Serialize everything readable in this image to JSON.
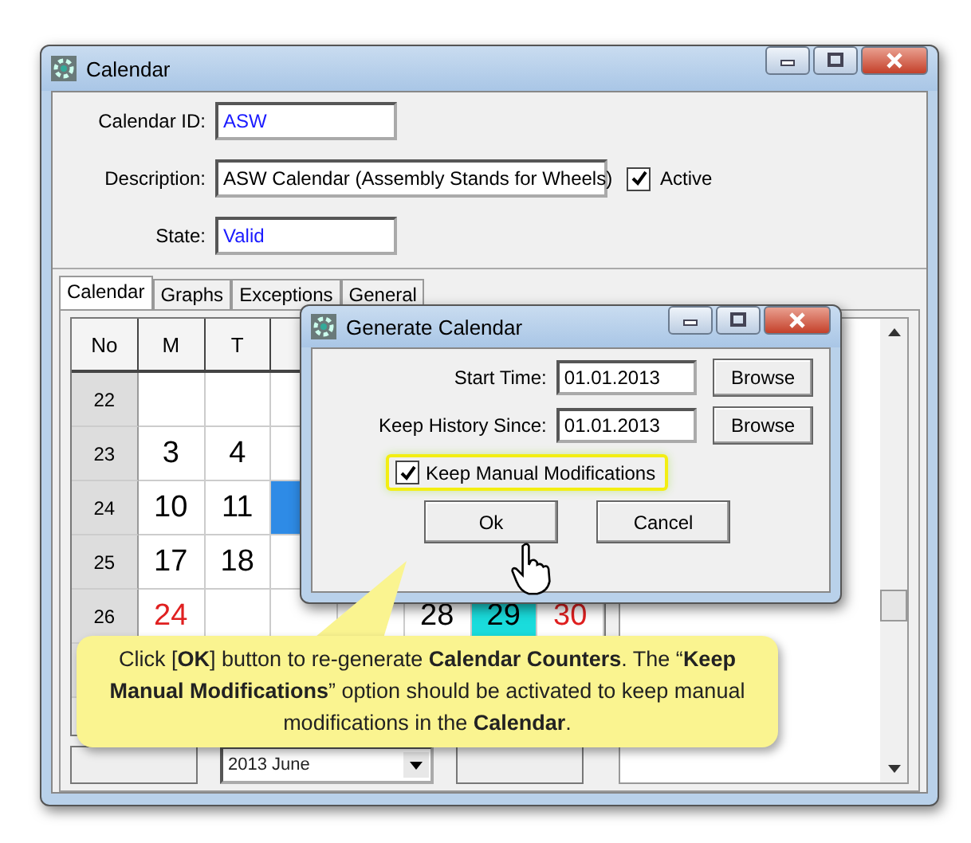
{
  "window": {
    "title": "Calendar"
  },
  "fields": [
    {
      "label": "Calendar ID:",
      "value": "ASW",
      "kind": "short"
    },
    {
      "label": "Description:",
      "value": "ASW Calendar (Assembly Stands for Wheels)",
      "kind": "long"
    },
    {
      "label": "State:",
      "value": "Valid",
      "kind": "short"
    }
  ],
  "active": {
    "label": "Active",
    "checked": true
  },
  "tabs": [
    {
      "label": "Calendar",
      "selected": true
    },
    {
      "label": "Graphs",
      "selected": false
    },
    {
      "label": "Exceptions",
      "selected": false
    },
    {
      "label": "General",
      "selected": false
    }
  ],
  "grid": {
    "columns": [
      "No",
      "M",
      "T"
    ],
    "rows": [
      {
        "week": "22",
        "days": [
          {
            "kind": "blank"
          },
          {
            "kind": "blank"
          },
          {
            "kind": "blank"
          },
          {
            "kind": "covered"
          },
          {
            "kind": "covered"
          },
          {
            "kind": "covered"
          },
          {
            "kind": "covered"
          }
        ]
      },
      {
        "week": "23",
        "days": [
          {
            "kind": "day",
            "text": "3"
          },
          {
            "kind": "day",
            "text": "4"
          },
          {
            "kind": "day"
          },
          {
            "kind": "covered"
          },
          {
            "kind": "covered"
          },
          {
            "kind": "covered"
          },
          {
            "kind": "covered"
          }
        ]
      },
      {
        "week": "24",
        "days": [
          {
            "kind": "day",
            "text": "10"
          },
          {
            "kind": "day",
            "text": "11"
          },
          {
            "kind": "selected"
          },
          {
            "kind": "covered"
          },
          {
            "kind": "covered"
          },
          {
            "kind": "covered"
          },
          {
            "kind": "covered"
          }
        ]
      },
      {
        "week": "25",
        "days": [
          {
            "kind": "day",
            "text": "17"
          },
          {
            "kind": "day",
            "text": "18"
          },
          {
            "kind": "day"
          },
          {
            "kind": "covered"
          },
          {
            "kind": "covered"
          },
          {
            "kind": "covered"
          },
          {
            "kind": "covered"
          }
        ]
      },
      {
        "week": "26",
        "days": [
          {
            "kind": "holiday",
            "text": "24"
          },
          {
            "kind": "blank"
          },
          {
            "kind": "blank"
          },
          {
            "kind": "blank"
          },
          {
            "kind": "day",
            "text": "28"
          },
          {
            "kind": "highlight",
            "text": "29"
          },
          {
            "kind": "holiday",
            "text": "30"
          }
        ]
      }
    ]
  },
  "month_select": {
    "value": "2013 June"
  },
  "dialog": {
    "title": "Generate Calendar",
    "fields": [
      {
        "label": "Start Time:",
        "value": "01.01.2013",
        "button": "Browse"
      },
      {
        "label": "Keep History Since:",
        "value": "01.01.2013",
        "button": "Browse"
      }
    ],
    "option": {
      "label": "Keep Manual Modifications",
      "checked": true,
      "highlighted": true
    },
    "buttons": [
      "Ok",
      "Cancel"
    ]
  },
  "callout": {
    "text": "Click [**OK**] button to re-generate **Calendar Counters**. The “**Keep Manual Modifications**” option should be activated to keep manual modifications in the **Calendar**."
  }
}
